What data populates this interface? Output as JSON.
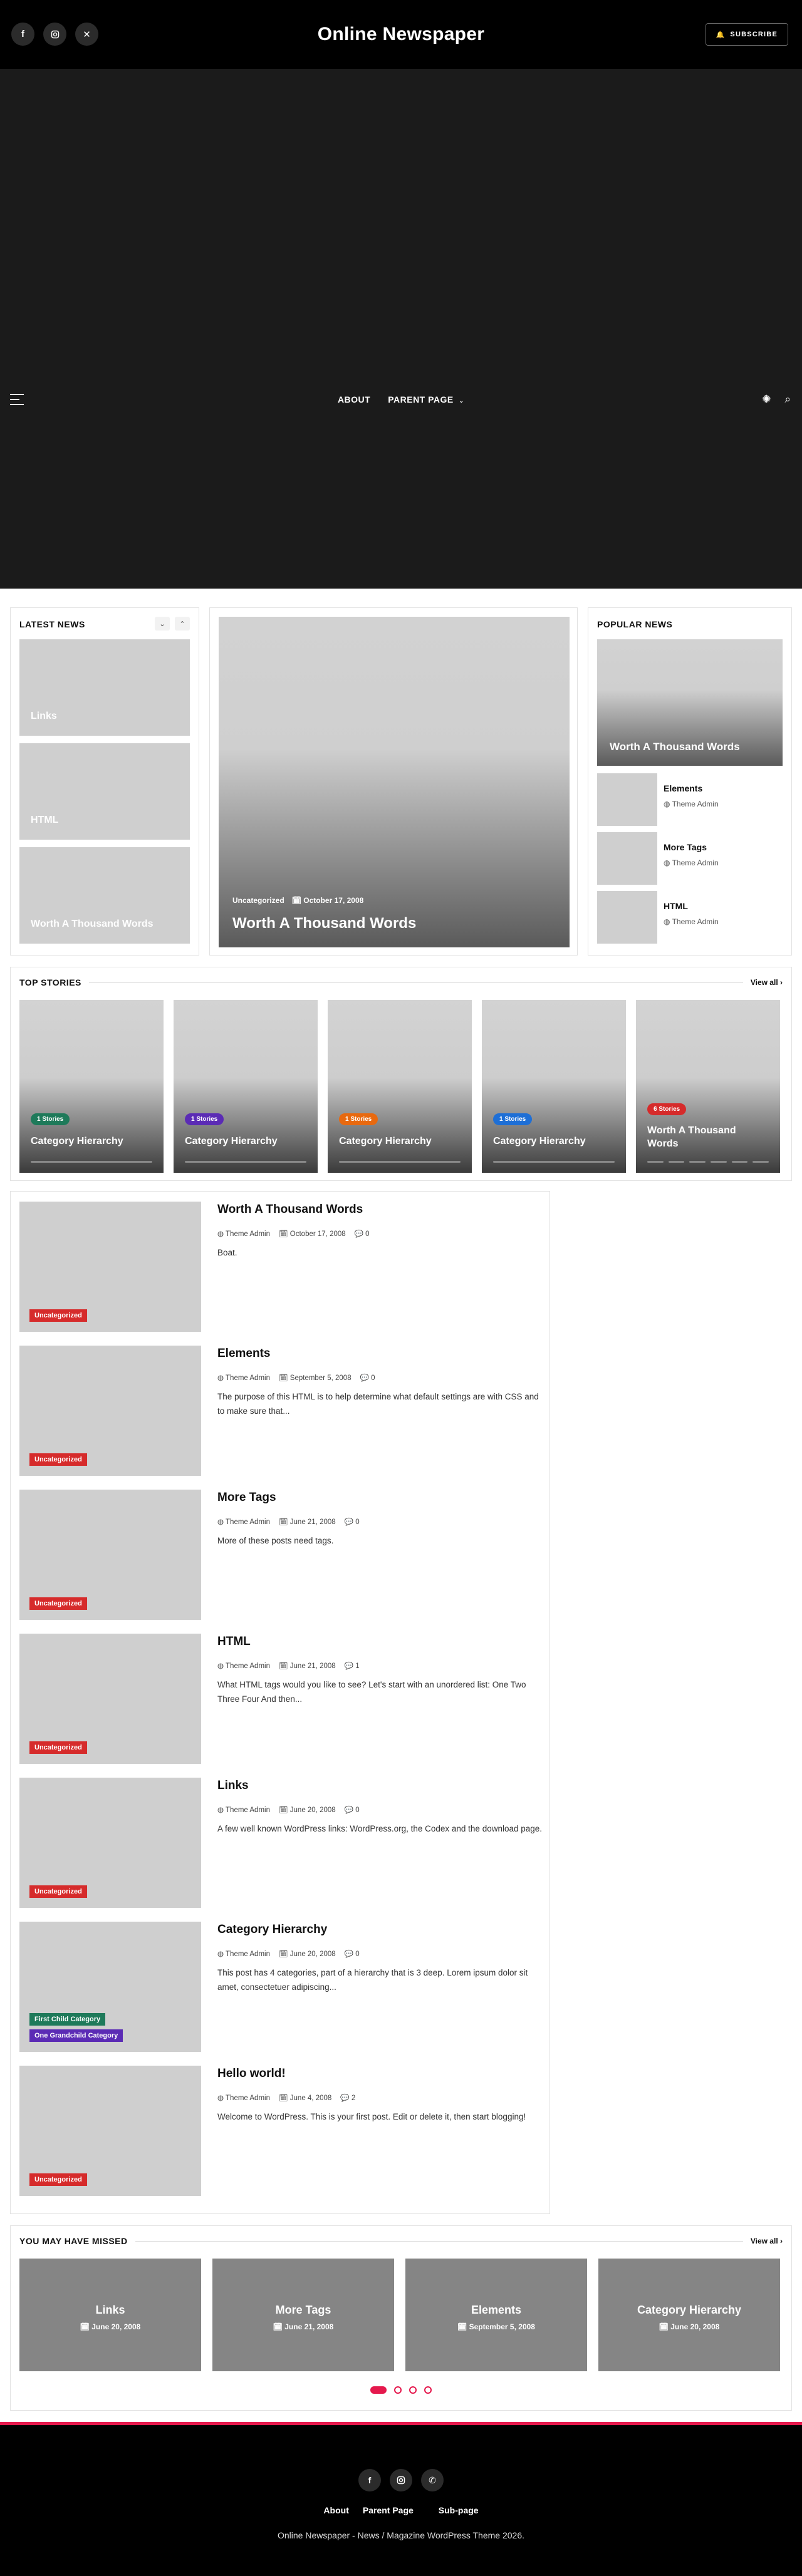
{
  "header": {
    "site_title": "Online Newspaper",
    "subscribe_label": "SUBSCRIBE",
    "social": [
      "f",
      "ig",
      "x"
    ]
  },
  "nav": {
    "items": [
      "ABOUT",
      "PARENT PAGE"
    ]
  },
  "latest_news": {
    "title": "LATEST NEWS",
    "items": [
      "Links",
      "HTML",
      "Worth A Thousand Words"
    ]
  },
  "featured": {
    "category": "Uncategorized",
    "date": "October 17, 2008",
    "title": "Worth A Thousand Words"
  },
  "popular_news": {
    "title": "POPULAR NEWS",
    "hero_title": "Worth A Thousand Words",
    "items": [
      {
        "title": "Elements",
        "author": "Theme Admin"
      },
      {
        "title": "More Tags",
        "author": "Theme Admin"
      },
      {
        "title": "HTML",
        "author": "Theme Admin"
      }
    ]
  },
  "top_stories": {
    "title": "TOP STORIES",
    "view_all": "View all",
    "items": [
      {
        "badge": "1 Stories",
        "title": "Category Hierarchy",
        "color": "#1e7a5a"
      },
      {
        "badge": "1 Stories",
        "title": "Category Hierarchy",
        "color": "#5b2bb5"
      },
      {
        "badge": "1 Stories",
        "title": "Category Hierarchy",
        "color": "#e8690f"
      },
      {
        "badge": "1 Stories",
        "title": "Category Hierarchy",
        "color": "#1e6fd6"
      },
      {
        "badge": "6 Stories",
        "title": "Worth A Thousand Words",
        "color": "#d62b2b"
      }
    ]
  },
  "posts": [
    {
      "tags": [
        {
          "label": "Uncategorized",
          "color": "#d62b2b"
        }
      ],
      "title": "Worth A Thousand Words",
      "author": "Theme Admin",
      "date": "October 17, 2008",
      "comments": "0",
      "excerpt": "Boat."
    },
    {
      "tags": [
        {
          "label": "Uncategorized",
          "color": "#d62b2b"
        }
      ],
      "title": "Elements",
      "author": "Theme Admin",
      "date": "September 5, 2008",
      "comments": "0",
      "excerpt": "The purpose of this HTML is to help determine what default settings are with CSS and to make sure that..."
    },
    {
      "tags": [
        {
          "label": "Uncategorized",
          "color": "#d62b2b"
        }
      ],
      "title": "More Tags",
      "author": "Theme Admin",
      "date": "June 21, 2008",
      "comments": "0",
      "excerpt": "More of these posts need tags."
    },
    {
      "tags": [
        {
          "label": "Uncategorized",
          "color": "#d62b2b"
        }
      ],
      "title": "HTML",
      "author": "Theme Admin",
      "date": "June 21, 2008",
      "comments": "1",
      "excerpt": "What HTML tags would you like to see? Let's start with an unordered list: One Two Three Four And then..."
    },
    {
      "tags": [
        {
          "label": "Uncategorized",
          "color": "#d62b2b"
        }
      ],
      "title": "Links",
      "author": "Theme Admin",
      "date": "June 20, 2008",
      "comments": "0",
      "excerpt": "A few well known WordPress links: WordPress.org, the Codex and the download page."
    },
    {
      "tags": [
        {
          "label": "First Child Category",
          "color": "#1e7a5a"
        },
        {
          "label": "One Grandchild Category",
          "color": "#5b2bb5"
        }
      ],
      "title": "Category Hierarchy",
      "author": "Theme Admin",
      "date": "June 20, 2008",
      "comments": "0",
      "excerpt": "This post has 4 categories, part of a hierarchy that is 3 deep. Lorem ipsum dolor sit amet, consectetuer adipiscing..."
    },
    {
      "tags": [
        {
          "label": "Uncategorized",
          "color": "#d62b2b"
        }
      ],
      "title": "Hello world!",
      "author": "Theme Admin",
      "date": "June 4, 2008",
      "comments": "2",
      "excerpt": "Welcome to WordPress. This is your first post. Edit or delete it, then start blogging!"
    }
  ],
  "missed": {
    "title": "YOU MAY HAVE MISSED",
    "view_all": "View all",
    "items": [
      {
        "title": "Links",
        "date": "June 20, 2008"
      },
      {
        "title": "More Tags",
        "date": "June 21, 2008"
      },
      {
        "title": "Elements",
        "date": "September 5, 2008"
      },
      {
        "title": "Category Hierarchy",
        "date": "June 20, 2008"
      }
    ]
  },
  "footer": {
    "links": [
      "About",
      "Parent Page",
      "Sub-page"
    ],
    "copyright": "Online Newspaper - News / Magazine WordPress Theme 2026."
  },
  "colors": {
    "accent": "#e5194d",
    "header_bg": "#000000",
    "hero_bg": "#1b1b1b"
  }
}
